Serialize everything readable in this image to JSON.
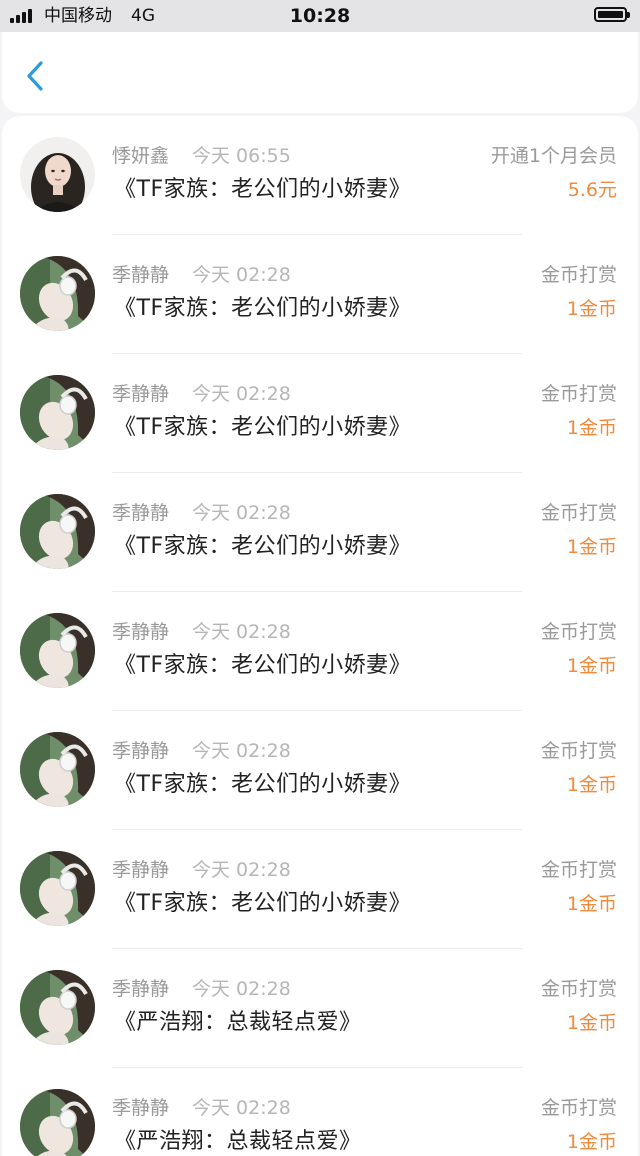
{
  "status_bar": {
    "carrier": "中国移动",
    "network": "4G",
    "time": "10:28"
  },
  "nav": {
    "back_icon": "chevron-left-icon",
    "accent_color": "#2a9bdc"
  },
  "colors": {
    "amount": "#f08a3c",
    "name": "#9a9a9a",
    "title": "#222222"
  },
  "records": [
    {
      "name": "悸妍鑫",
      "time": "今天 06:55",
      "book": "《TF家族：老公们的小娇妻》",
      "action": "开通1个月会员",
      "amount": "5.6元",
      "avatar": "avatar-a"
    },
    {
      "name": "季静静",
      "time": "今天 02:28",
      "book": "《TF家族：老公们的小娇妻》",
      "action": "金币打赏",
      "amount": "1金币",
      "avatar": "avatar-b"
    },
    {
      "name": "季静静",
      "time": "今天 02:28",
      "book": "《TF家族：老公们的小娇妻》",
      "action": "金币打赏",
      "amount": "1金币",
      "avatar": "avatar-b"
    },
    {
      "name": "季静静",
      "time": "今天 02:28",
      "book": "《TF家族：老公们的小娇妻》",
      "action": "金币打赏",
      "amount": "1金币",
      "avatar": "avatar-b"
    },
    {
      "name": "季静静",
      "time": "今天 02:28",
      "book": "《TF家族：老公们的小娇妻》",
      "action": "金币打赏",
      "amount": "1金币",
      "avatar": "avatar-b"
    },
    {
      "name": "季静静",
      "time": "今天 02:28",
      "book": "《TF家族：老公们的小娇妻》",
      "action": "金币打赏",
      "amount": "1金币",
      "avatar": "avatar-b"
    },
    {
      "name": "季静静",
      "time": "今天 02:28",
      "book": "《TF家族：老公们的小娇妻》",
      "action": "金币打赏",
      "amount": "1金币",
      "avatar": "avatar-b"
    },
    {
      "name": "季静静",
      "time": "今天 02:28",
      "book": "《严浩翔：总裁轻点爱》",
      "action": "金币打赏",
      "amount": "1金币",
      "avatar": "avatar-b"
    },
    {
      "name": "季静静",
      "time": "今天 02:28",
      "book": "《严浩翔：总裁轻点爱》",
      "action": "金币打赏",
      "amount": "1金币",
      "avatar": "avatar-b"
    }
  ]
}
